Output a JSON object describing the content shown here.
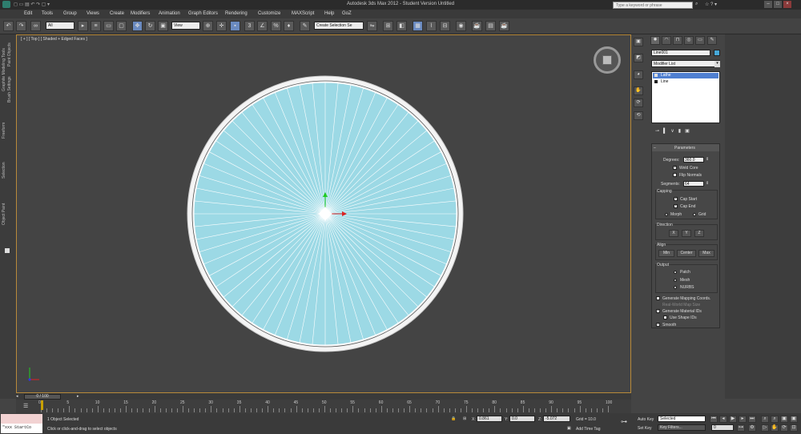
{
  "window": {
    "title": "Autodesk 3ds Max  2012  - Student Version   Untitled",
    "search_placeholder": "Type a keyword or phrase"
  },
  "menu": [
    "Edit",
    "Tools",
    "Group",
    "Views",
    "Create",
    "Modifiers",
    "Animation",
    "Graph Editors",
    "Rendering",
    "Customize",
    "MAXScript",
    "Help",
    "GoZ"
  ],
  "toolbar": {
    "selection_filter": "All",
    "ref_coord": "View",
    "named_selection": "Create Selection Se"
  },
  "left_tabs": [
    "Graphite Modeling Tools",
    "Paint Objects",
    "Brush Settings",
    "Freeform",
    "Selection",
    "Object Paint"
  ],
  "viewport": {
    "label": "[ + ] [ Top ] [ Shaded + Edged Faces ]",
    "disc_fill": "#9cd9e5"
  },
  "command_panel": {
    "object_name": "Line001",
    "object_color": "#47a8d8",
    "modifier_list": "Modifier List",
    "stack": [
      "Lathe",
      "Line"
    ]
  },
  "parameters": {
    "rollout": "Parameters",
    "degrees_label": "Degrees:",
    "degrees_value": "360.0",
    "weld_core": "Weld Core",
    "flip_normals": "Flip Normals",
    "segments_label": "Segments:",
    "segments_value": "64",
    "capping": "Capping",
    "cap_start": "Cap Start",
    "cap_end": "Cap End",
    "morph": "Morph",
    "grid": "Grid",
    "direction": "Direction",
    "dir_x": "X",
    "dir_y": "Y",
    "dir_z": "Z",
    "align": "Align",
    "align_min": "Min",
    "align_center": "Center",
    "align_max": "Max",
    "output": "Output",
    "patch": "Patch",
    "mesh": "Mesh",
    "nurbs": "NURBS",
    "gen_mapping": "Generate Mapping Coords.",
    "real_world": "Real-World Map Size",
    "gen_matids": "Generate Material IDs",
    "use_shape_ids": "Use Shape IDs",
    "smooth": "Smooth"
  },
  "timeline": {
    "slider": "0 / 100",
    "ticks": [
      "0",
      "5",
      "10",
      "15",
      "20",
      "25",
      "30",
      "35",
      "40",
      "45",
      "50",
      "55",
      "60",
      "65",
      "70",
      "75",
      "80",
      "85",
      "90",
      "95",
      "100"
    ]
  },
  "status": {
    "maxscript": "\"xxx StartCo",
    "selected": "1 Object Selected",
    "prompt": "Click or click-and-drag to select objects",
    "x_label": "X:",
    "x_value": "0.861",
    "y_label": "Y:",
    "y_value": "0.0",
    "z_label": "Z:",
    "z_value": "-5.072",
    "grid": "Grid = 10.0",
    "add_time_tag": "Add Time Tag",
    "auto_key": "Auto Key",
    "set_key": "Set Key",
    "key_mode": "Selected",
    "key_filters": "Key Filters...",
    "frame": "0"
  }
}
